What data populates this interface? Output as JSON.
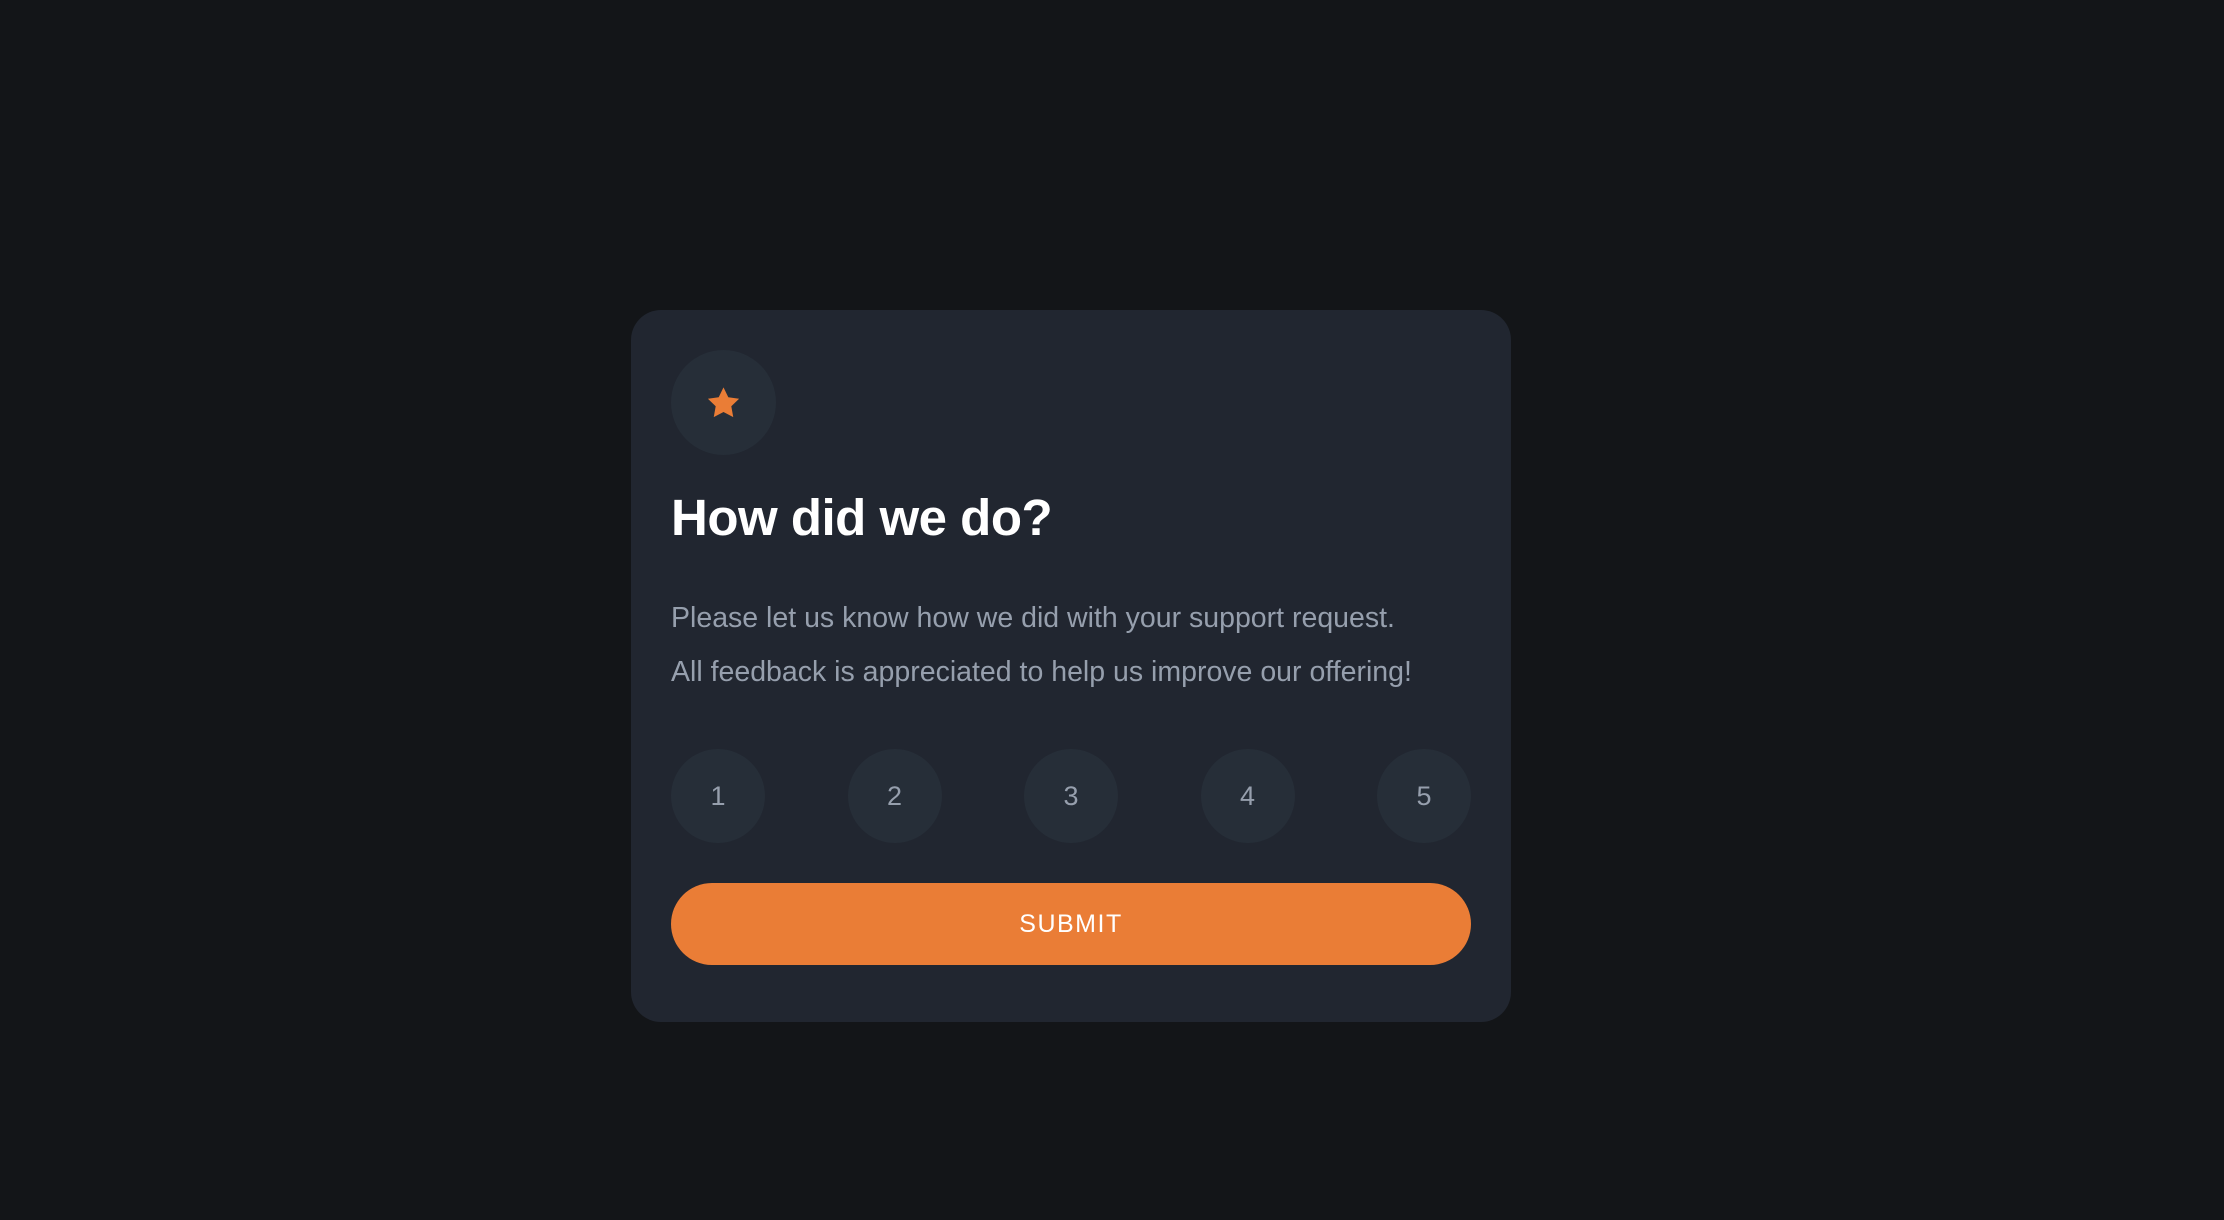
{
  "colors": {
    "page_background": "#131518",
    "card_background": "#212630",
    "circle_background": "#262e38",
    "accent": "#ea7d36",
    "heading_text": "#ffffff",
    "body_text": "#969fad"
  },
  "card": {
    "icon": "star-icon",
    "title": "How did we do?",
    "description_lines": [
      "Please let us know how we did with your support request.",
      "All feedback is appreciated to help us improve our offering!"
    ],
    "ratings": [
      "1",
      "2",
      "3",
      "4",
      "5"
    ],
    "selected_rating": null,
    "submit_label": "SUBMIT"
  }
}
